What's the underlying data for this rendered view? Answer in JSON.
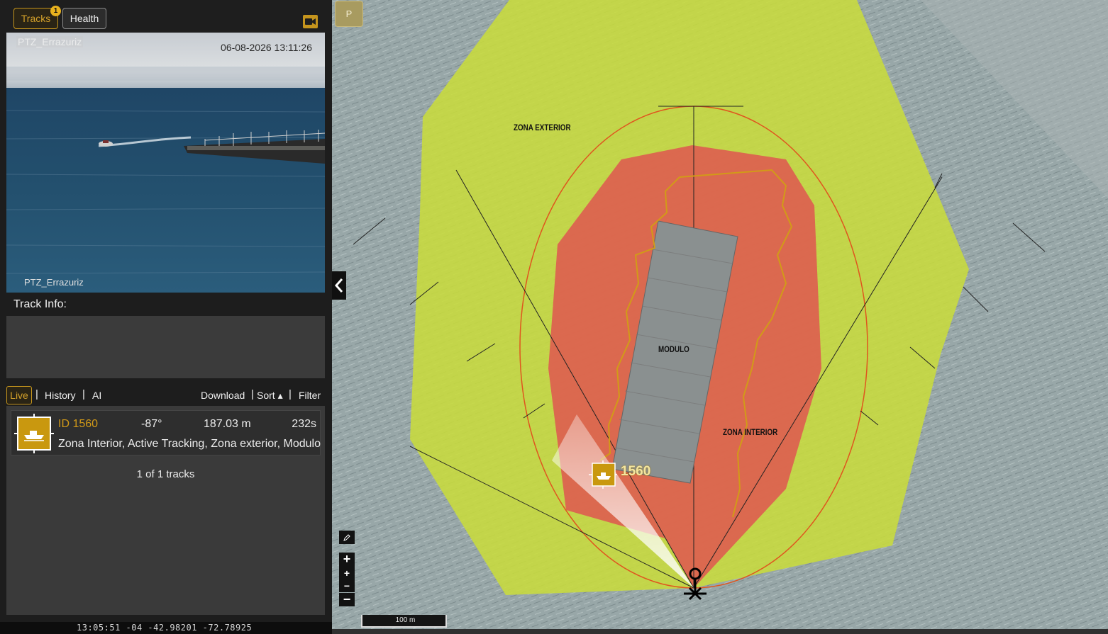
{
  "tabs": {
    "tracks": "Tracks",
    "health": "Health",
    "tracks_badge": "1"
  },
  "video": {
    "camera_name_top": "PTZ_Errazuriz",
    "timestamp": "06-08-2026 13:11:26",
    "camera_name_bottom": "PTZ_Errazuriz"
  },
  "track_info": {
    "title": "Track Info:"
  },
  "filters": {
    "live": "Live",
    "history": "History",
    "ai": "AI",
    "download": "Download",
    "sort": "Sort ▴",
    "filter": "Filter",
    "separator": "|"
  },
  "tracks": [
    {
      "id": "ID 1560",
      "bearing": "-87°",
      "range": "187.03 m",
      "age": "232s",
      "zones": "Zona Interior, Active Tracking, Zona exterior, Modulo"
    }
  ],
  "track_count": "1 of 1 tracks",
  "status_bar": "13:05:51 -04  -42.98201  -72.78925",
  "map": {
    "p_button": "P",
    "labels": {
      "zona_exterior": "ZONA EXTERIOR",
      "modulo": "MODULO",
      "zona_interior": "ZONA INTERIOR"
    },
    "track_label": "1560",
    "scale": "100 m",
    "zoom": {
      "in": "+",
      "in_small": "+",
      "out_small": "−",
      "out": "−"
    },
    "colors": {
      "outer_zone": "#c8dc3c",
      "inner_zone": "#e05050",
      "accent": "#d29a18"
    }
  }
}
